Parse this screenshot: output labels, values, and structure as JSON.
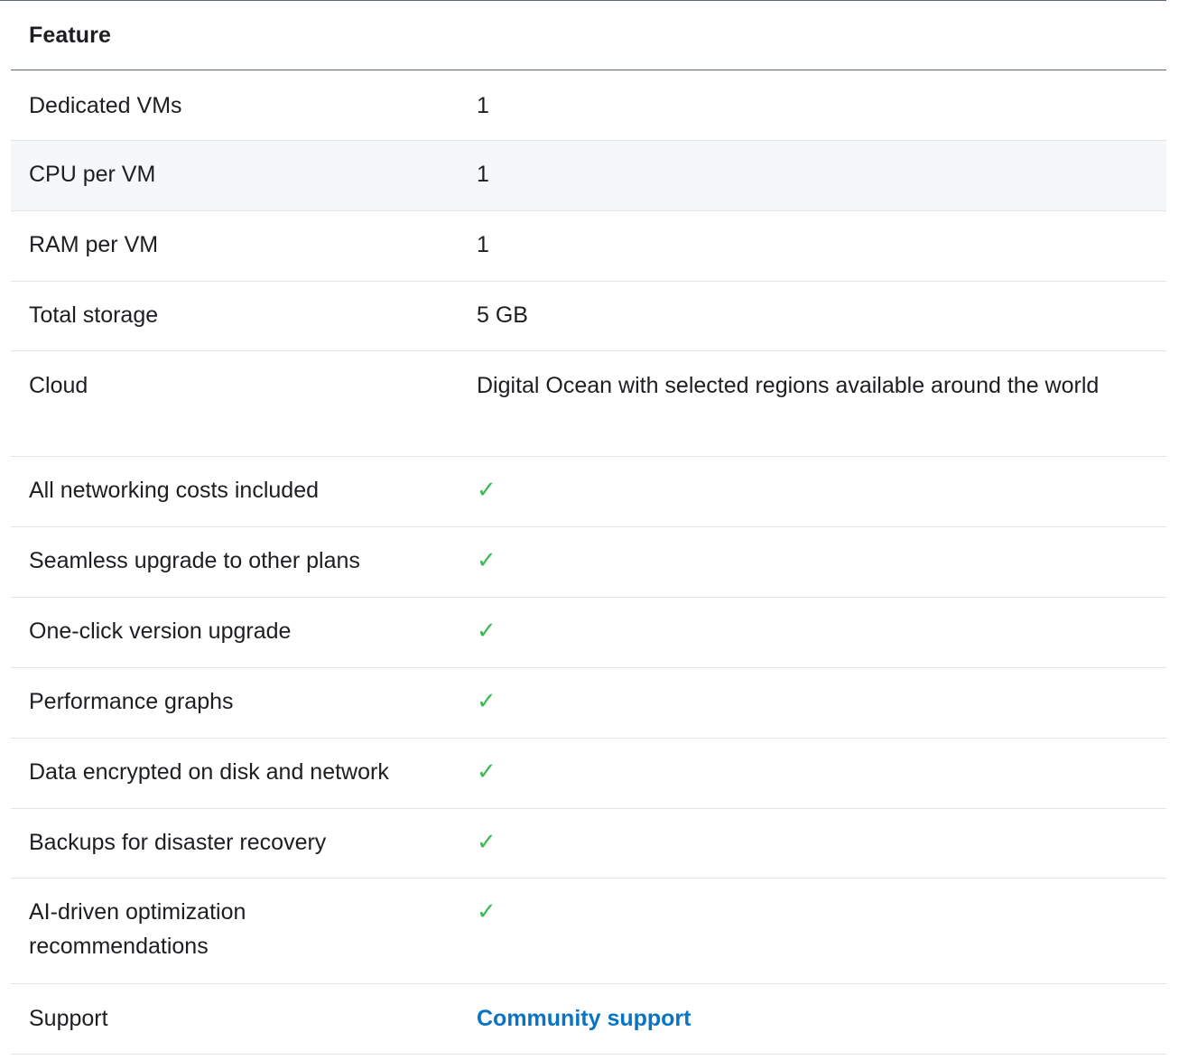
{
  "table": {
    "header": "Feature",
    "rows": [
      {
        "feature": "Dedicated VMs",
        "value": "1",
        "kind": "text"
      },
      {
        "feature": "CPU per VM",
        "value": "1",
        "kind": "text"
      },
      {
        "feature": "RAM per VM",
        "value": "1",
        "kind": "text"
      },
      {
        "feature": "Total storage",
        "value": "5 GB",
        "kind": "text"
      },
      {
        "feature": "Cloud",
        "value": "Digital Ocean with selected regions available around the world",
        "kind": "text"
      },
      {
        "feature": "All networking costs included",
        "value": "✓",
        "kind": "check"
      },
      {
        "feature": "Seamless upgrade to other plans",
        "value": "✓",
        "kind": "check"
      },
      {
        "feature": "One-click version upgrade",
        "value": "✓",
        "kind": "check"
      },
      {
        "feature": "Performance graphs",
        "value": "✓",
        "kind": "check"
      },
      {
        "feature": "Data encrypted on disk and network",
        "value": "✓",
        "kind": "check"
      },
      {
        "feature": "Backups for disaster recovery",
        "value": "✓",
        "kind": "check"
      },
      {
        "feature": "AI-driven optimization recommendations",
        "value": "✓",
        "kind": "check"
      },
      {
        "feature": "Support",
        "value": "Community support",
        "kind": "link"
      }
    ]
  },
  "colors": {
    "check": "#3cba54",
    "link": "#0a74c4",
    "alt_row": "#f6f7f9"
  },
  "icons": {
    "check": "checkmark-icon"
  }
}
